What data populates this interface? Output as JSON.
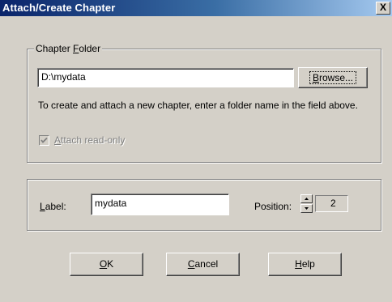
{
  "window": {
    "title": "Attach/Create Chapter",
    "close_glyph": "X"
  },
  "chapter_folder": {
    "legend_pre": "Chapter ",
    "legend_accel": "F",
    "legend_post": "older",
    "path_value": "D:\\mydata",
    "browse_accel": "B",
    "browse_rest": "rowse...",
    "help_text": "To create and attach a new chapter, enter a folder name in the field above.",
    "readonly_accel": "A",
    "readonly_rest": "ttach read-only",
    "readonly_checked": true
  },
  "label_section": {
    "label_accel": "L",
    "label_rest": "abel:",
    "label_value": "mydata",
    "position_label": "Position:",
    "position_value": "2"
  },
  "buttons": {
    "ok_accel": "O",
    "ok_rest": "K",
    "cancel_accel": "C",
    "cancel_rest": "ancel",
    "help_accel": "H",
    "help_rest": "elp"
  },
  "icons": [
    "close-icon",
    "checkmark-icon",
    "spin-up-arrow-icon",
    "spin-down-arrow-icon"
  ]
}
